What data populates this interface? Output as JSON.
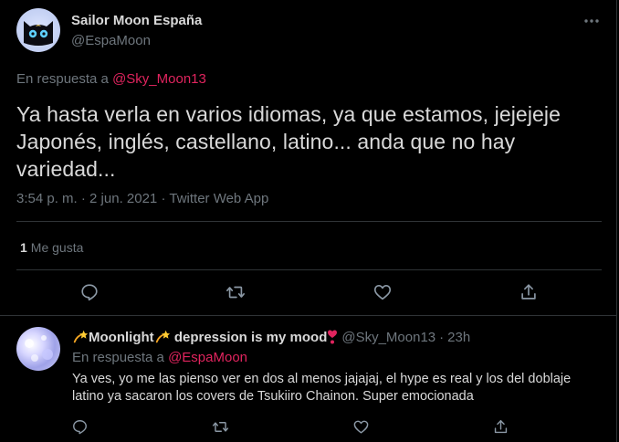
{
  "colors": {
    "background": "#000000",
    "text_primary": "#d9d9d9",
    "text_secondary": "#6e767d",
    "link": "#e0245e",
    "divider": "#2f3336"
  },
  "main_tweet": {
    "author_name": "Sailor Moon España",
    "author_handle": "@EspaMoon",
    "reply_prefix": "En respuesta a",
    "reply_to": "@Sky_Moon13",
    "text": "Ya hasta verla en varios idiomas, ya que estamos, jejejeje Japonés, inglés, castellano, latino... anda que no hay variedad...",
    "time": "3:54 p. m.",
    "separator": "·",
    "date": "2 jun. 2021",
    "source": "Twitter Web App",
    "like_count": "1",
    "like_label": "Me gusta",
    "icons": {
      "more": "more-horizontal-icon",
      "reply": "reply-icon",
      "retweet": "retweet-icon",
      "like": "heart-icon",
      "share": "share-icon"
    }
  },
  "reply_tweet": {
    "author_name_part1": "Moonlight",
    "author_name_part2": "depression is my mood",
    "author_handle": "@Sky_Moon13",
    "separator": "·",
    "time": "23h",
    "reply_prefix": "En respuesta a",
    "reply_to": "@EspaMoon",
    "text": "Ya ves, yo me las pienso ver en dos al menos jajajaj, el hype es real y los del doblaje latino ya sacaron los covers de Tsukiiro Chainon. Super emocionada",
    "emoji_names": [
      "dizzy-star-emoji",
      "dizzy-star-emoji",
      "heart-exclamation-emoji"
    ]
  }
}
